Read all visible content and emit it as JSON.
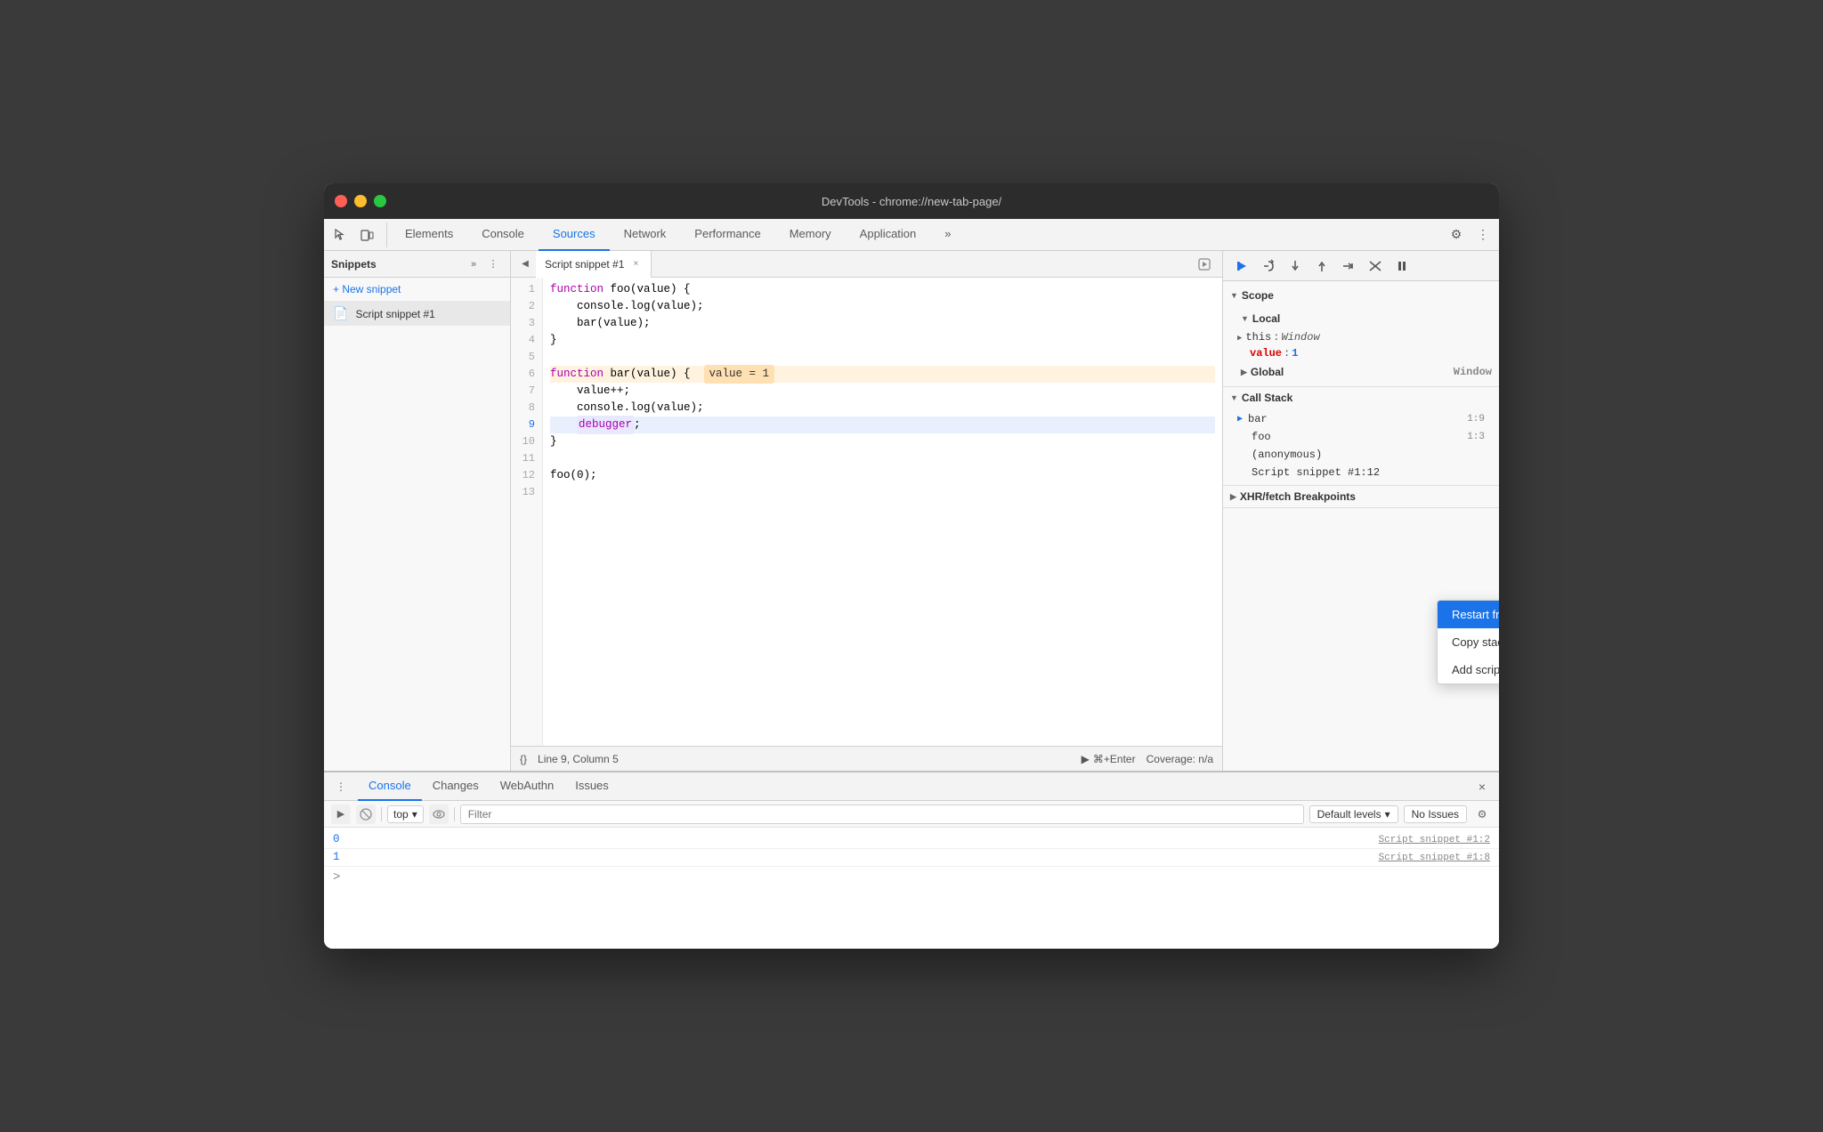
{
  "window": {
    "title": "DevTools - chrome://new-tab-page/"
  },
  "traffic_lights": {
    "red_label": "close",
    "yellow_label": "minimize",
    "green_label": "maximize"
  },
  "top_tabs": {
    "items": [
      {
        "label": "Elements",
        "active": false
      },
      {
        "label": "Console",
        "active": false
      },
      {
        "label": "Sources",
        "active": true
      },
      {
        "label": "Network",
        "active": false
      },
      {
        "label": "Performance",
        "active": false
      },
      {
        "label": "Memory",
        "active": false
      },
      {
        "label": "Application",
        "active": false
      }
    ],
    "more_label": "»",
    "settings_icon": "⚙",
    "more_icon": "⋮"
  },
  "sidebar": {
    "title": "Snippets",
    "more_icon": "»",
    "menu_icon": "⋮",
    "new_snippet_label": "+ New snippet",
    "snippet_item_label": "Script snippet #1"
  },
  "editor": {
    "nav_icon": "◀",
    "tab_label": "Script snippet #1",
    "close_icon": "×",
    "run_icon": "▶",
    "lines": [
      {
        "num": 1,
        "content": "function foo(value) {",
        "type": "normal"
      },
      {
        "num": 2,
        "content": "    console.log(value);",
        "type": "normal"
      },
      {
        "num": 3,
        "content": "    bar(value);",
        "type": "normal"
      },
      {
        "num": 4,
        "content": "}",
        "type": "normal"
      },
      {
        "num": 5,
        "content": "",
        "type": "normal"
      },
      {
        "num": 6,
        "content": "function bar(value) {   value = 1",
        "type": "highlighted"
      },
      {
        "num": 7,
        "content": "    value++;",
        "type": "normal"
      },
      {
        "num": 8,
        "content": "    console.log(value);",
        "type": "normal"
      },
      {
        "num": 9,
        "content": "    debugger;",
        "type": "debugger"
      },
      {
        "num": 10,
        "content": "}",
        "type": "normal"
      },
      {
        "num": 11,
        "content": "",
        "type": "normal"
      },
      {
        "num": 12,
        "content": "foo(0);",
        "type": "normal"
      },
      {
        "num": 13,
        "content": "",
        "type": "normal"
      }
    ],
    "status_bar": {
      "pretty_print": "{}",
      "position": "Line 9, Column 5",
      "run_label": "⌘+Enter",
      "coverage": "Coverage: n/a"
    }
  },
  "right_panel": {
    "debug_buttons": [
      {
        "icon": "▶",
        "label": "resume",
        "active": true
      },
      {
        "icon": "↺",
        "label": "step-over"
      },
      {
        "icon": "↓",
        "label": "step-into"
      },
      {
        "icon": "↑",
        "label": "step-out"
      },
      {
        "icon": "→|",
        "label": "step"
      },
      {
        "icon": "✗",
        "label": "deactivate"
      },
      {
        "icon": "⏸",
        "label": "pause-on-exceptions"
      }
    ],
    "scope_section": {
      "title": "Scope",
      "local_section": {
        "title": "Local",
        "items": [
          {
            "key": "this",
            "colon": ":",
            "value": "Window",
            "type": "obj"
          },
          {
            "key": "value",
            "colon": ":",
            "value": "1",
            "type": "num"
          }
        ]
      },
      "global_section": {
        "title": "Global",
        "value": "Window"
      }
    },
    "call_stack_section": {
      "title": "Call Stack",
      "items": [
        {
          "name": "bar",
          "location": "1:9",
          "active": true
        },
        {
          "name": "foo",
          "location": "1:3"
        },
        {
          "name": "(anonymous)",
          "location": ""
        },
        {
          "name": "Script snippet #1:12",
          "location": ""
        }
      ]
    }
  },
  "context_menu": {
    "items": [
      {
        "label": "Restart frame",
        "selected": true
      },
      {
        "label": "Copy stack trace",
        "selected": false
      },
      {
        "label": "Add script to ignore list",
        "selected": false
      }
    ]
  },
  "bottom_panel": {
    "menu_icon": "⋮",
    "tabs": [
      {
        "label": "Console",
        "active": true
      },
      {
        "label": "Changes",
        "active": false
      },
      {
        "label": "WebAuthn",
        "active": false
      },
      {
        "label": "Issues",
        "active": false
      }
    ],
    "close_icon": "×",
    "console_toolbar": {
      "run_icon": "▶",
      "clear_icon": "🚫",
      "top_label": "top",
      "dropdown_icon": "▾",
      "eye_icon": "👁",
      "filter_placeholder": "Filter",
      "default_levels_label": "Default levels",
      "dropdown_icon2": "▾",
      "no_issues_label": "No Issues",
      "settings_icon": "⚙"
    },
    "console_output": [
      {
        "value": "0",
        "source": "Script snippet #1:2"
      },
      {
        "value": "1",
        "source": "Script snippet #1:8"
      }
    ],
    "prompt": ">"
  }
}
